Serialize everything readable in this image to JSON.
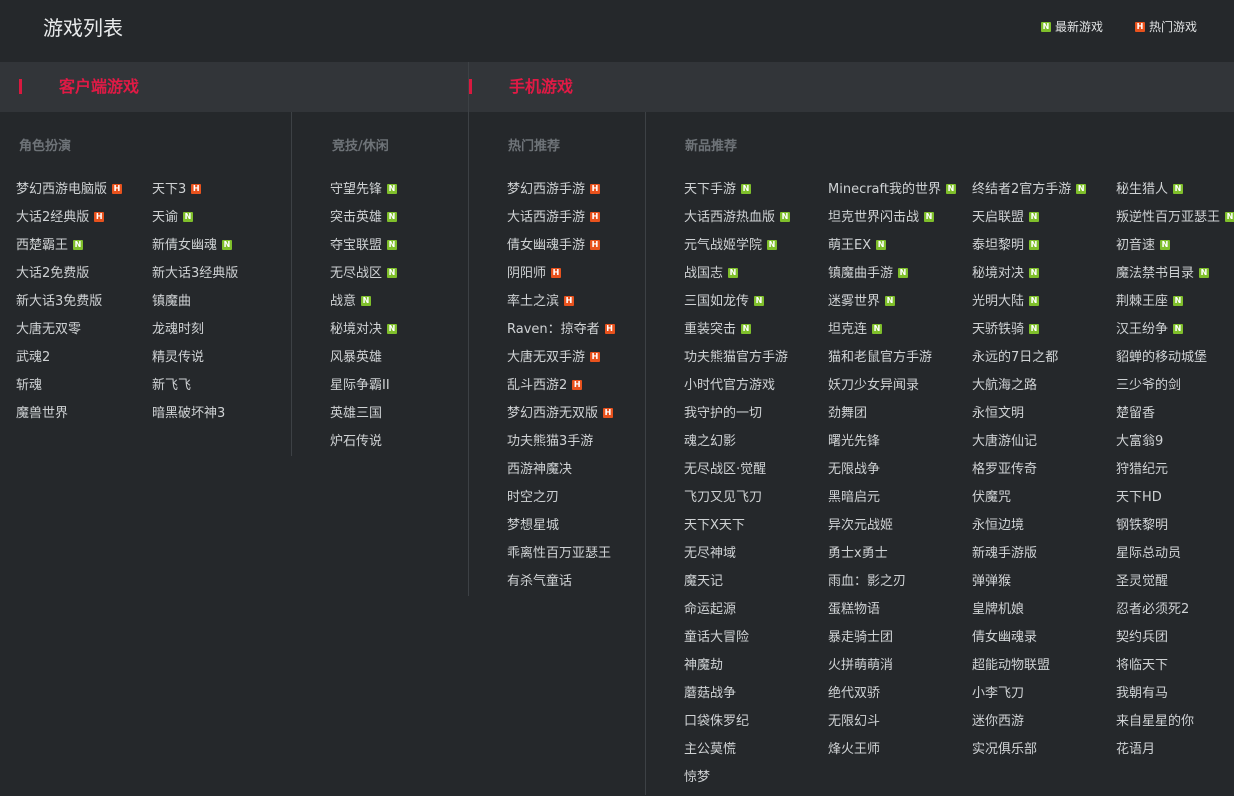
{
  "header": {
    "title": "游戏列表",
    "legend": [
      {
        "badge": "N",
        "type": "new",
        "label": "最新游戏"
      },
      {
        "badge": "H",
        "type": "hot",
        "label": "热门游戏"
      }
    ]
  },
  "colors": {
    "background": "#25282b",
    "section_bar": "#323539",
    "accent_red": "#e01a45",
    "badge_new": "#7fbf2b",
    "badge_hot": "#e8521d"
  },
  "sections": {
    "client": {
      "title": "客户端游戏"
    },
    "mobile": {
      "title": "手机游戏"
    }
  },
  "columns": {
    "rpg": {
      "header": "角色扮演"
    },
    "casual": {
      "header": "竞技/休闲"
    },
    "hot": {
      "header": "热门推荐"
    },
    "new": {
      "header": "新品推荐"
    }
  },
  "lists": {
    "rpg_a": [
      {
        "name": "梦幻西游电脑版",
        "badge": "H"
      },
      {
        "name": "大话2经典版",
        "badge": "H"
      },
      {
        "name": "西楚霸王",
        "badge": "N"
      },
      {
        "name": "大话2免费版",
        "badge": ""
      },
      {
        "name": "新大话3免费版",
        "badge": ""
      },
      {
        "name": "大唐无双零",
        "badge": ""
      },
      {
        "name": "武魂2",
        "badge": ""
      },
      {
        "name": "斩魂",
        "badge": ""
      },
      {
        "name": "魔兽世界",
        "badge": ""
      }
    ],
    "rpg_b": [
      {
        "name": "天下3",
        "badge": "H"
      },
      {
        "name": "天谕",
        "badge": "N"
      },
      {
        "name": "新倩女幽魂",
        "badge": "N"
      },
      {
        "name": "新大话3经典版",
        "badge": ""
      },
      {
        "name": "镇魔曲",
        "badge": ""
      },
      {
        "name": "龙魂时刻",
        "badge": ""
      },
      {
        "name": "精灵传说",
        "badge": ""
      },
      {
        "name": "新飞飞",
        "badge": ""
      },
      {
        "name": "暗黑破坏神3",
        "badge": ""
      }
    ],
    "casual": [
      {
        "name": "守望先锋",
        "badge": "N"
      },
      {
        "name": "突击英雄",
        "badge": "N"
      },
      {
        "name": "夺宝联盟",
        "badge": "N"
      },
      {
        "name": "无尽战区",
        "badge": "N"
      },
      {
        "name": "战意",
        "badge": "N"
      },
      {
        "name": "秘境对决",
        "badge": "N"
      },
      {
        "name": "风暴英雄",
        "badge": ""
      },
      {
        "name": "星际争霸II",
        "badge": ""
      },
      {
        "name": "英雄三国",
        "badge": ""
      },
      {
        "name": "炉石传说",
        "badge": ""
      }
    ],
    "hot": [
      {
        "name": "梦幻西游手游",
        "badge": "H"
      },
      {
        "name": "大话西游手游",
        "badge": "H"
      },
      {
        "name": "倩女幽魂手游",
        "badge": "H"
      },
      {
        "name": "阴阳师",
        "badge": "H"
      },
      {
        "name": "率土之滨",
        "badge": "H"
      },
      {
        "name": "Raven：掠夺者",
        "badge": "H"
      },
      {
        "name": "大唐无双手游",
        "badge": "H"
      },
      {
        "name": "乱斗西游2",
        "badge": "H"
      },
      {
        "name": "梦幻西游无双版",
        "badge": "H"
      },
      {
        "name": "功夫熊猫3手游",
        "badge": ""
      },
      {
        "name": "西游神魔决",
        "badge": ""
      },
      {
        "name": "时空之刃",
        "badge": ""
      },
      {
        "name": "梦想星城",
        "badge": ""
      },
      {
        "name": "乖离性百万亚瑟王",
        "badge": ""
      },
      {
        "name": "有杀气童话",
        "badge": ""
      }
    ],
    "new_a": [
      {
        "name": "天下手游",
        "badge": "N"
      },
      {
        "name": "大话西游热血版",
        "badge": "N"
      },
      {
        "name": "元气战姬学院",
        "badge": "N"
      },
      {
        "name": "战国志",
        "badge": "N"
      },
      {
        "name": "三国如龙传",
        "badge": "N"
      },
      {
        "name": "重装突击",
        "badge": "N"
      },
      {
        "name": "功夫熊猫官方手游",
        "badge": ""
      },
      {
        "name": "小时代官方游戏",
        "badge": ""
      },
      {
        "name": "我守护的一切",
        "badge": ""
      },
      {
        "name": "魂之幻影",
        "badge": ""
      },
      {
        "name": "无尽战区·觉醒",
        "badge": ""
      },
      {
        "name": "飞刀又见飞刀",
        "badge": ""
      },
      {
        "name": "天下X天下",
        "badge": ""
      },
      {
        "name": "无尽神域",
        "badge": ""
      },
      {
        "name": "魔天记",
        "badge": ""
      },
      {
        "name": "命运起源",
        "badge": ""
      },
      {
        "name": "童话大冒险",
        "badge": ""
      },
      {
        "name": "神魔劫",
        "badge": ""
      },
      {
        "name": "蘑菇战争",
        "badge": ""
      },
      {
        "name": "口袋侏罗纪",
        "badge": ""
      },
      {
        "name": "主公莫慌",
        "badge": ""
      },
      {
        "name": "惊梦",
        "badge": ""
      }
    ],
    "new_b": [
      {
        "name": "Minecraft我的世界",
        "badge": "N"
      },
      {
        "name": "坦克世界闪击战",
        "badge": "N"
      },
      {
        "name": "萌王EX",
        "badge": "N"
      },
      {
        "name": "镇魔曲手游",
        "badge": "N"
      },
      {
        "name": "迷雾世界",
        "badge": "N"
      },
      {
        "name": "坦克连",
        "badge": "N"
      },
      {
        "name": "猫和老鼠官方手游",
        "badge": ""
      },
      {
        "name": "妖刀少女异闻录",
        "badge": ""
      },
      {
        "name": "劲舞团",
        "badge": ""
      },
      {
        "name": "曙光先锋",
        "badge": ""
      },
      {
        "name": "无限战争",
        "badge": ""
      },
      {
        "name": "黑暗启元",
        "badge": ""
      },
      {
        "name": "异次元战姬",
        "badge": ""
      },
      {
        "name": "勇士x勇士",
        "badge": ""
      },
      {
        "name": "雨血：影之刃",
        "badge": ""
      },
      {
        "name": "蛋糕物语",
        "badge": ""
      },
      {
        "name": "暴走骑士团",
        "badge": ""
      },
      {
        "name": "火拼萌萌消",
        "badge": ""
      },
      {
        "name": "绝代双骄",
        "badge": ""
      },
      {
        "name": "无限幻斗",
        "badge": ""
      },
      {
        "name": "烽火王师",
        "badge": ""
      }
    ],
    "new_c": [
      {
        "name": "终结者2官方手游",
        "badge": "N"
      },
      {
        "name": "天启联盟",
        "badge": "N"
      },
      {
        "name": "泰坦黎明",
        "badge": "N"
      },
      {
        "name": "秘境对决",
        "badge": "N"
      },
      {
        "name": "光明大陆",
        "badge": "N"
      },
      {
        "name": "天骄铁骑",
        "badge": "N"
      },
      {
        "name": "永远的7日之都",
        "badge": ""
      },
      {
        "name": "大航海之路",
        "badge": ""
      },
      {
        "name": "永恒文明",
        "badge": ""
      },
      {
        "name": "大唐游仙记",
        "badge": ""
      },
      {
        "name": "格罗亚传奇",
        "badge": ""
      },
      {
        "name": "伏魔咒",
        "badge": ""
      },
      {
        "name": "永恒边境",
        "badge": ""
      },
      {
        "name": "新魂手游版",
        "badge": ""
      },
      {
        "name": "弹弹猴",
        "badge": ""
      },
      {
        "name": "皇牌机娘",
        "badge": ""
      },
      {
        "name": "倩女幽魂录",
        "badge": ""
      },
      {
        "name": "超能动物联盟",
        "badge": ""
      },
      {
        "name": "小李飞刀",
        "badge": ""
      },
      {
        "name": "迷你西游",
        "badge": ""
      },
      {
        "name": "实况俱乐部",
        "badge": ""
      }
    ],
    "new_d": [
      {
        "name": "秘生猎人",
        "badge": "N"
      },
      {
        "name": "叛逆性百万亚瑟王",
        "badge": "N"
      },
      {
        "name": "初音速",
        "badge": "N"
      },
      {
        "name": "魔法禁书目录",
        "badge": "N"
      },
      {
        "name": "荆棘王座",
        "badge": "N"
      },
      {
        "name": "汉王纷争",
        "badge": "N"
      },
      {
        "name": "貂蝉的移动城堡",
        "badge": ""
      },
      {
        "name": "三少爷的剑",
        "badge": ""
      },
      {
        "name": "楚留香",
        "badge": ""
      },
      {
        "name": "大富翁9",
        "badge": ""
      },
      {
        "name": "狩猎纪元",
        "badge": ""
      },
      {
        "name": "天下HD",
        "badge": ""
      },
      {
        "name": "钢铁黎明",
        "badge": ""
      },
      {
        "name": "星际总动员",
        "badge": ""
      },
      {
        "name": "圣灵觉醒",
        "badge": ""
      },
      {
        "name": "忍者必须死2",
        "badge": ""
      },
      {
        "name": "契约兵团",
        "badge": ""
      },
      {
        "name": "将临天下",
        "badge": ""
      },
      {
        "name": "我朝有马",
        "badge": ""
      },
      {
        "name": "来自星星的你",
        "badge": ""
      },
      {
        "name": "花语月",
        "badge": ""
      }
    ]
  }
}
